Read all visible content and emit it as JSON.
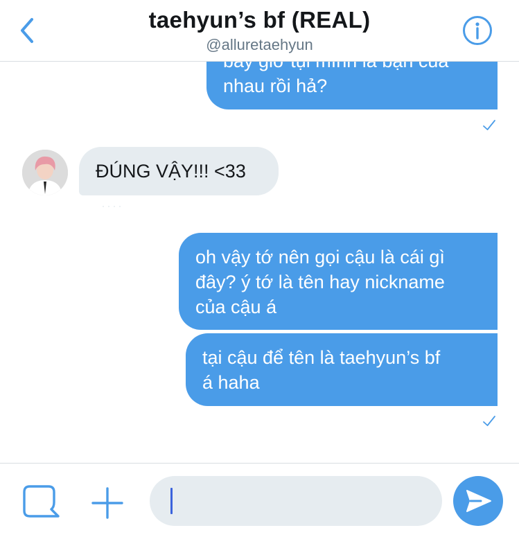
{
  "header": {
    "title": "taehyun’s bf (REAL)",
    "handle": "@alluretaehyun"
  },
  "messages": [
    {
      "direction": "outgoing",
      "text": "bây giờ tụi mình là bạn của\nnhau rồi hả?"
    },
    {
      "direction": "incoming",
      "text": "ĐÚNG VẬY!!! <33"
    },
    {
      "direction": "outgoing",
      "text": "oh vậy tớ nên gọi cậu là cái gì\nđây? ý tớ là tên hay nickname\ncủa cậu á"
    },
    {
      "direction": "outgoing",
      "text": "tại cậu để tên là taehyun’s bf\ná haha"
    }
  ],
  "composer": {
    "value": "",
    "placeholder": ""
  },
  "icons": {
    "back": "chevron-left-icon",
    "info": "info-icon",
    "gif": "gif-square-icon",
    "add": "plus-icon",
    "send": "send-arrow-icon",
    "read": "checkmark-icon"
  },
  "colors": {
    "accent": "#4a9ce8",
    "incoming_bubble": "#e6ecf0",
    "title_text": "#14171a",
    "handle_text": "#657786"
  }
}
